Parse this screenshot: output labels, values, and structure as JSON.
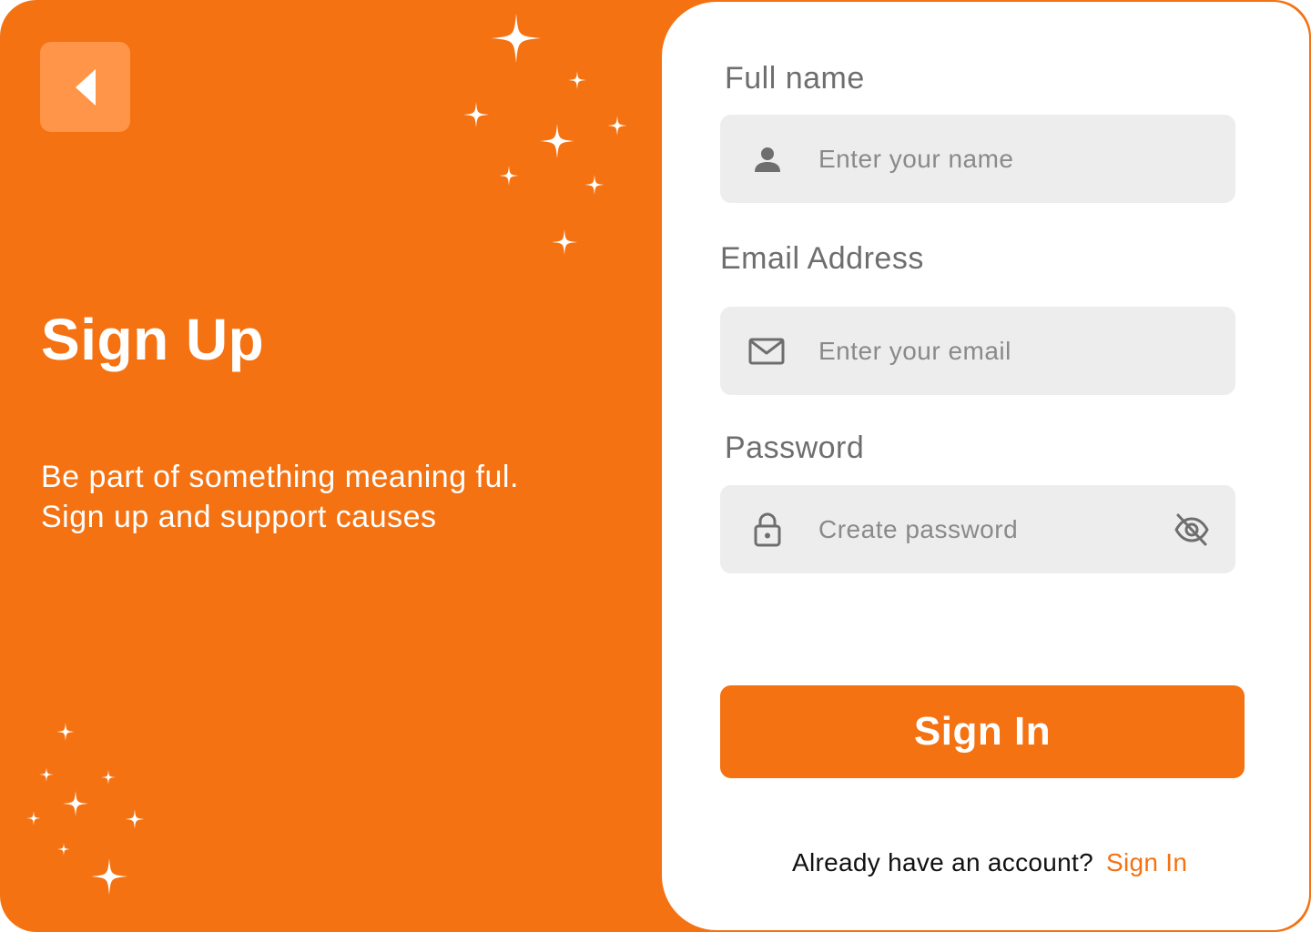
{
  "left_panel": {
    "back_button": {
      "icon": "chevron-left-icon"
    },
    "title": "Sign Up",
    "subtitle_lines": [
      "Be part of something meaning ful.",
      "Sign up and support causes"
    ]
  },
  "form": {
    "full_name": {
      "label": "Full name",
      "placeholder": "Enter your name",
      "icon": "user-icon"
    },
    "email": {
      "label": "Email Address",
      "placeholder": "Enter your email",
      "icon": "mail-icon"
    },
    "password": {
      "label": "Password",
      "placeholder": "Create password",
      "icon": "lock-icon",
      "toggle_icon": "eye-off-icon"
    },
    "submit_label": "Sign In",
    "footer": {
      "prompt": "Already have an account?",
      "link": "Sign In"
    }
  },
  "colors": {
    "brand_orange": "#F47212",
    "back_button_bg": "#FF9549",
    "field_bg": "#EDEDED",
    "label_gray": "#6E6E6E",
    "placeholder_gray": "#8A8A8A"
  }
}
